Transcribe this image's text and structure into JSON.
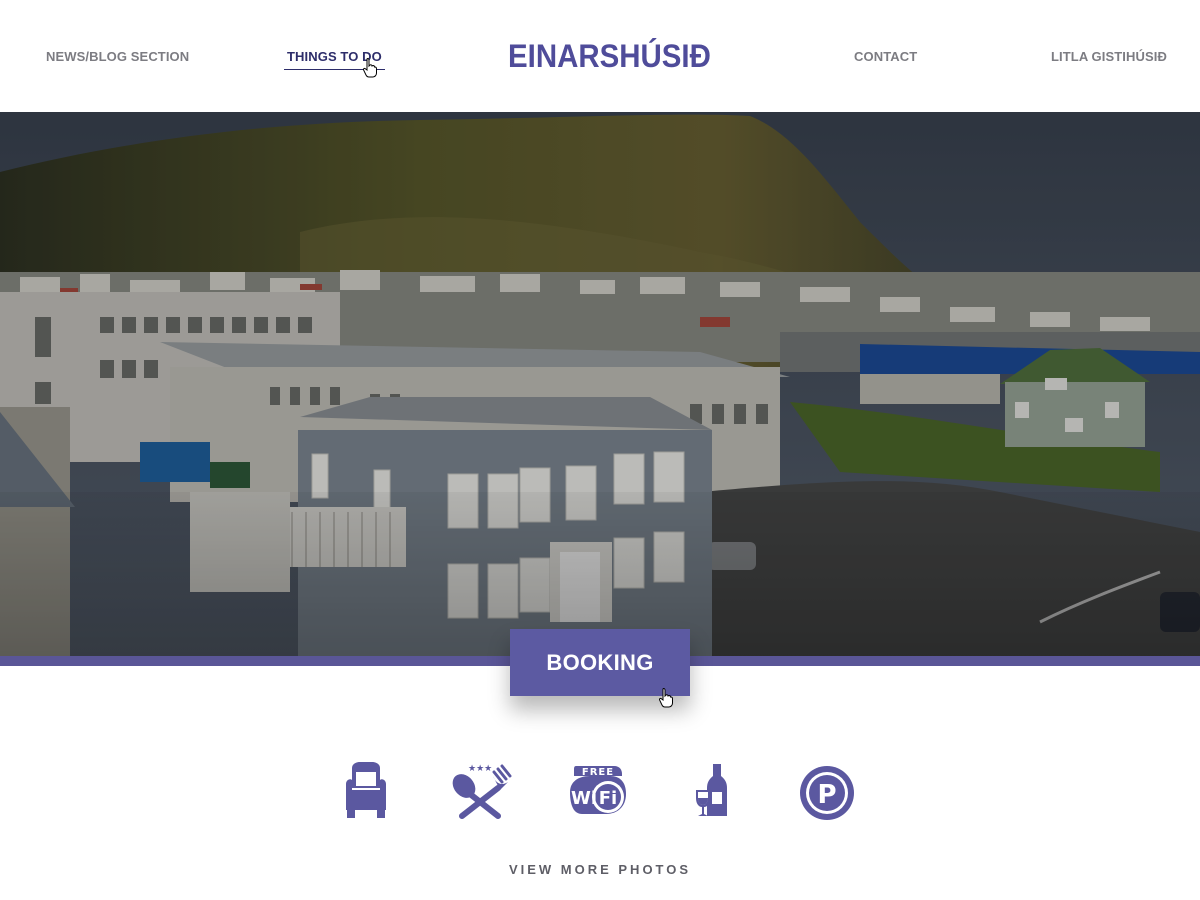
{
  "nav": {
    "left": [
      {
        "label": "NEWS/BLOG SECTION"
      },
      {
        "label": "THINGS TO DO",
        "active": true
      }
    ],
    "right": [
      {
        "label": "CONTACT"
      },
      {
        "label": "LITLA GISTIHÚSIÐ"
      }
    ]
  },
  "logo": {
    "text": "EINARSHÚSIÐ"
  },
  "hero": {
    "image": "Aerial view of a small town with houses below a mountain"
  },
  "booking": {
    "label": "BOOKING"
  },
  "amenities": [
    {
      "icon": "armchair-icon"
    },
    {
      "icon": "restaurant-icon",
      "stars": 3
    },
    {
      "icon": "free-wifi-icon",
      "badge": "FREE",
      "text": "Wi Fi"
    },
    {
      "icon": "wine-icon"
    },
    {
      "icon": "parking-icon",
      "text": "P"
    }
  ],
  "view_more": {
    "label": "VIEW MORE PHOTOS"
  },
  "colors": {
    "accent": "#5c5aa2",
    "nav_text": "#7c7c82",
    "nav_active": "#2d2d6a"
  }
}
